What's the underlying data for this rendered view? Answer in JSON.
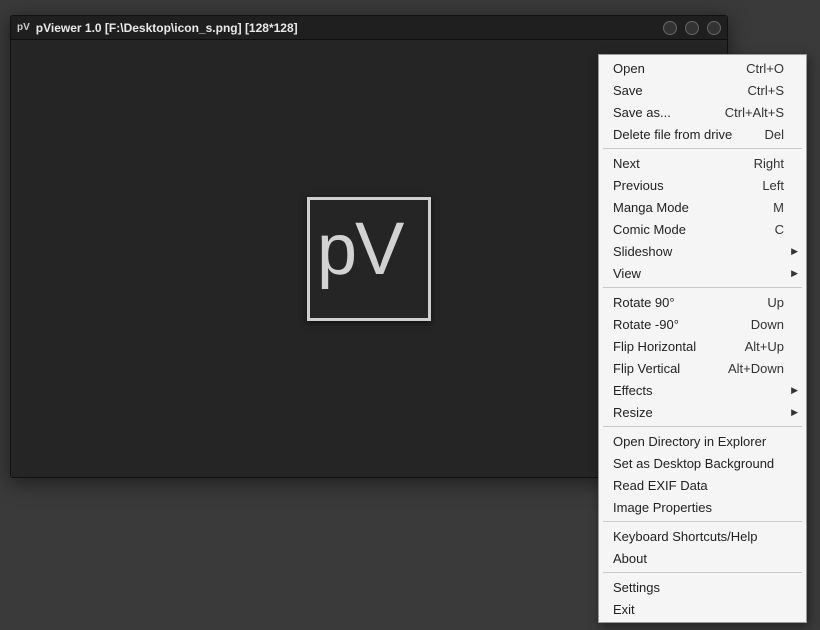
{
  "window": {
    "icon_text": "pV",
    "title": "pViewer 1.0 [F:\\Desktop\\icon_s.png] [128*128]",
    "logo_text": "pV"
  },
  "menu": {
    "groups": [
      [
        {
          "label": "Open",
          "shortcut": "Ctrl+O"
        },
        {
          "label": "Save",
          "shortcut": "Ctrl+S"
        },
        {
          "label": "Save as...",
          "shortcut": "Ctrl+Alt+S"
        },
        {
          "label": "Delete file from drive",
          "shortcut": "Del"
        }
      ],
      [
        {
          "label": "Next",
          "shortcut": "Right"
        },
        {
          "label": "Previous",
          "shortcut": "Left"
        },
        {
          "label": "Manga Mode",
          "shortcut": "M"
        },
        {
          "label": "Comic Mode",
          "shortcut": "C"
        },
        {
          "label": "Slideshow",
          "submenu": true
        },
        {
          "label": "View",
          "submenu": true
        }
      ],
      [
        {
          "label": "Rotate 90°",
          "shortcut": "Up"
        },
        {
          "label": "Rotate -90°",
          "shortcut": "Down"
        },
        {
          "label": "Flip Horizontal",
          "shortcut": "Alt+Up"
        },
        {
          "label": "Flip Vertical",
          "shortcut": "Alt+Down"
        },
        {
          "label": "Effects",
          "submenu": true
        },
        {
          "label": "Resize",
          "submenu": true
        }
      ],
      [
        {
          "label": "Open Directory in Explorer"
        },
        {
          "label": "Set as Desktop Background"
        },
        {
          "label": "Read EXIF Data"
        },
        {
          "label": "Image Properties"
        }
      ],
      [
        {
          "label": "Keyboard Shortcuts/Help"
        },
        {
          "label": "About"
        }
      ],
      [
        {
          "label": "Settings"
        },
        {
          "label": "Exit"
        }
      ]
    ]
  }
}
